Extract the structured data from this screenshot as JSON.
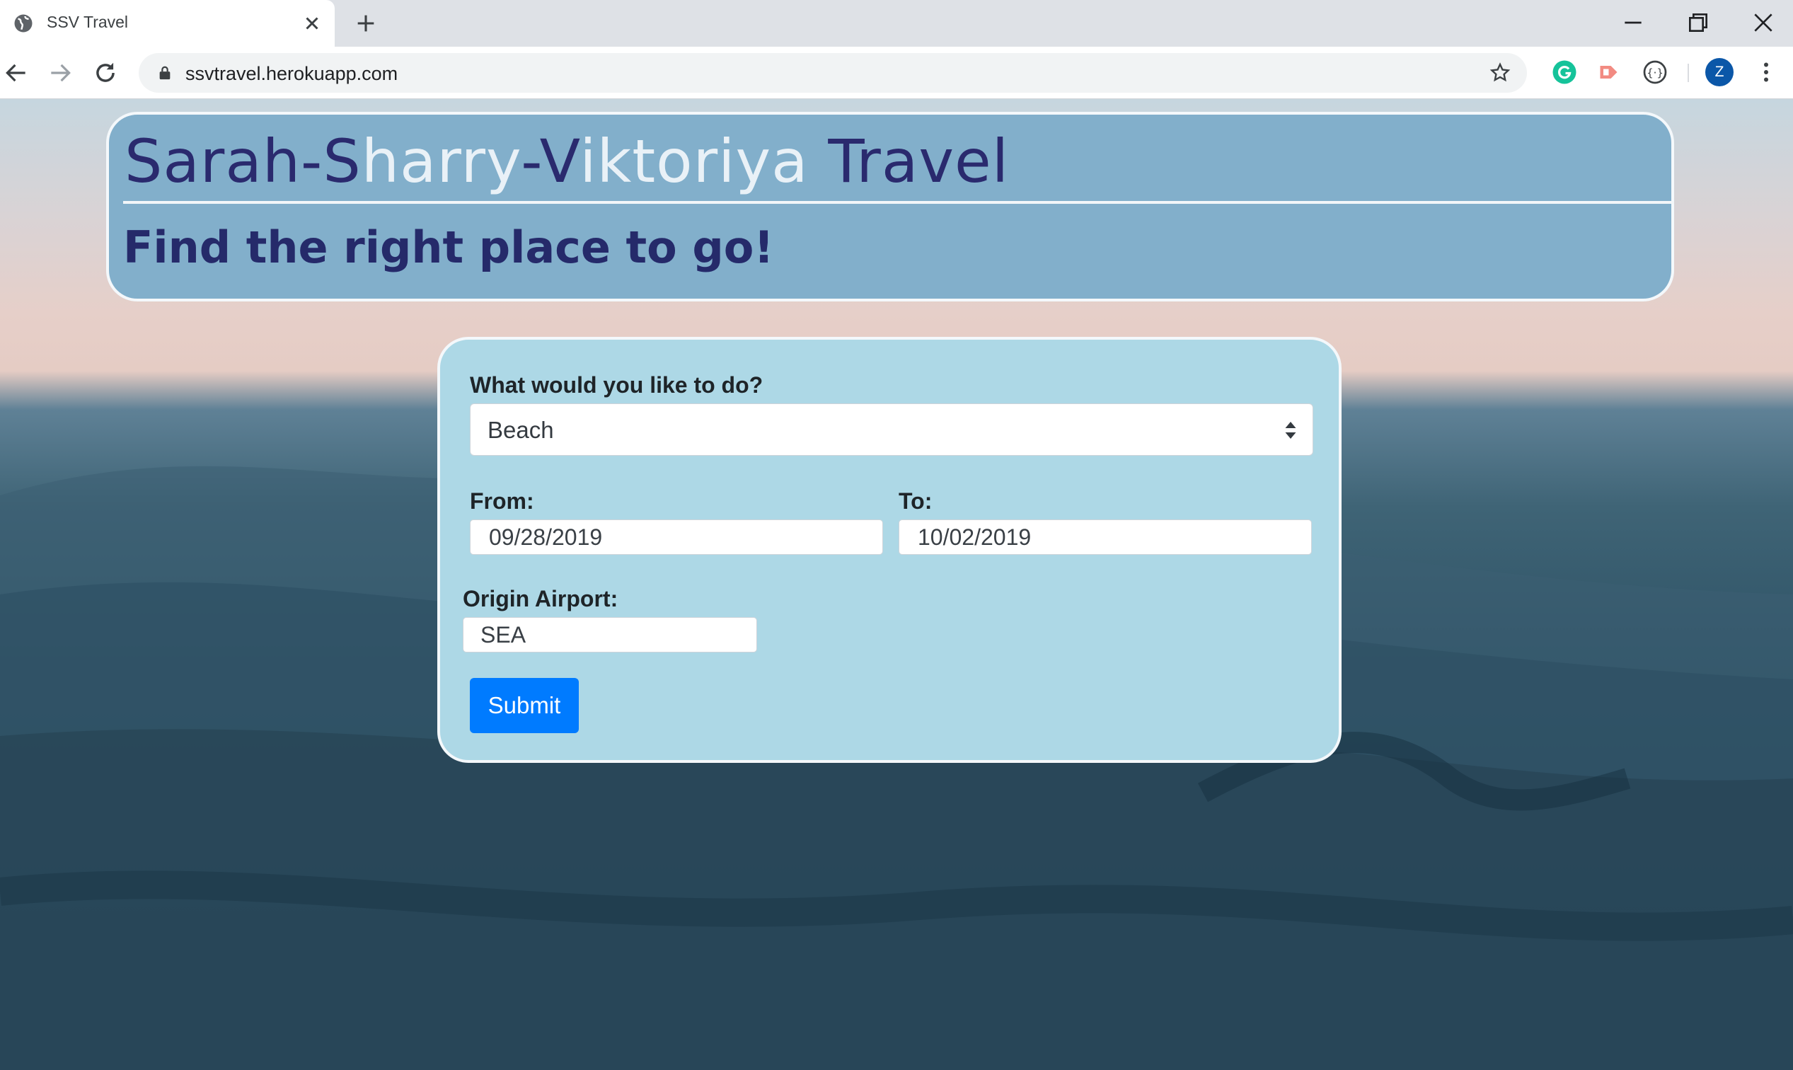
{
  "browser": {
    "tab_title": "SSV Travel",
    "url": "ssvtravel.herokuapp.com",
    "avatar_letter": "Z",
    "extensions": [
      "grammarly-icon",
      "cast-extension-icon",
      "code-extension-icon"
    ]
  },
  "header": {
    "title_parts": [
      {
        "text": "S",
        "style": "dark"
      },
      {
        "text": "arah-",
        "style": "dark"
      },
      {
        "text": "S",
        "style": "dark"
      },
      {
        "text": "harry",
        "style": "lite"
      },
      {
        "text": "-",
        "style": "dark"
      },
      {
        "text": "V",
        "style": "dark"
      },
      {
        "text": "iktoriya",
        "style": "lite"
      },
      {
        "text": " Travel",
        "style": "dark"
      }
    ],
    "tagline": "Find the right place to go!"
  },
  "form": {
    "activity_label": "What would you like to do?",
    "activity_value": "Beach",
    "from_label": "From:",
    "from_value": "09/28/2019",
    "to_label": "To:",
    "to_value": "10/02/2019",
    "origin_label": "Origin Airport:",
    "origin_value": "SEA",
    "submit_label": "Submit"
  },
  "colors": {
    "header_bg": "#82afcb",
    "card_bg": "#add8e6",
    "title_dark": "#2a2a6e",
    "submit_bg": "#007bff"
  }
}
